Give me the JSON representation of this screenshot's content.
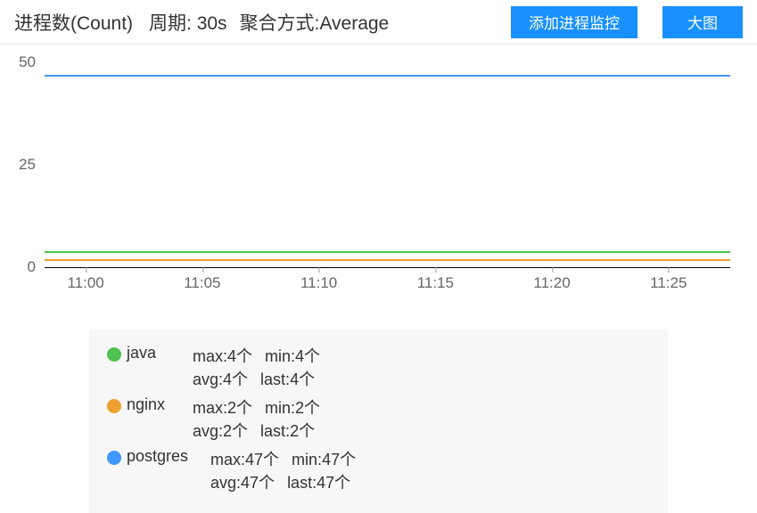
{
  "header": {
    "title": "进程数(Count)",
    "period_label": "周期: 30s",
    "aggregate_label": "聚合方式:Average",
    "add_button": "添加进程监控",
    "big_button": "大图"
  },
  "chart_data": {
    "type": "line",
    "ylim": [
      0,
      50
    ],
    "yticks": [
      0,
      25,
      50
    ],
    "x": [
      "11:00",
      "11:05",
      "11:10",
      "11:15",
      "11:20",
      "11:25"
    ],
    "series": [
      {
        "name": "java",
        "color": "#4fc24f",
        "values": [
          4,
          4,
          4,
          4,
          4,
          4
        ],
        "stats": {
          "max": "4个",
          "min": "4个",
          "avg": "4个",
          "last": "4个"
        }
      },
      {
        "name": "nginx",
        "color": "#f0a030",
        "values": [
          2,
          2,
          2,
          2,
          2,
          2
        ],
        "stats": {
          "max": "2个",
          "min": "2个",
          "avg": "2个",
          "last": "2个"
        }
      },
      {
        "name": "postgres",
        "color": "#4098ff",
        "values": [
          47,
          47,
          47,
          47,
          47,
          47
        ],
        "stats": {
          "max": "47个",
          "min": "47个",
          "avg": "47个",
          "last": "47个"
        }
      }
    ]
  },
  "stat_labels": {
    "max": "max:",
    "min": "min:",
    "avg": "avg:",
    "last": "last:"
  }
}
